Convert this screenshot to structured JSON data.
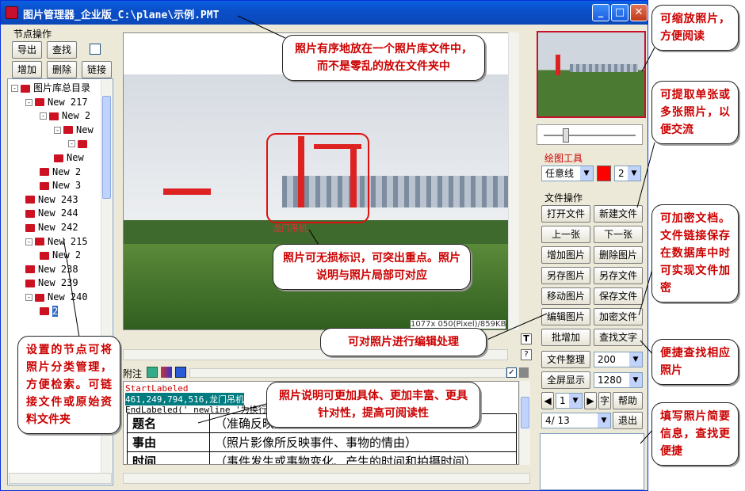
{
  "window": {
    "title": "图片管理器_企业版_C:\\plane\\示例.PMT",
    "buttons": {
      "minimize": "_",
      "maximize": "□",
      "close": "✕"
    }
  },
  "node_ops": {
    "label": "节点操作",
    "export": "导出",
    "find": "查找",
    "add": "增加",
    "delete": "删除",
    "link": "链接"
  },
  "tree": {
    "items": [
      {
        "label": "图片库总目录",
        "indent": 0,
        "expander": "-"
      },
      {
        "label": "New 217",
        "indent": 1,
        "expander": "-"
      },
      {
        "label": "New 2",
        "indent": 2,
        "expander": "-"
      },
      {
        "label": "New",
        "indent": 3,
        "expander": "-"
      },
      {
        "label": "",
        "indent": 4,
        "expander": "-"
      },
      {
        "label": "New",
        "indent": 3,
        "expander": ""
      },
      {
        "label": "New 2",
        "indent": 2,
        "expander": ""
      },
      {
        "label": "New 3",
        "indent": 2,
        "expander": ""
      },
      {
        "label": "New 243",
        "indent": 1,
        "expander": ""
      },
      {
        "label": "New 244",
        "indent": 1,
        "expander": ""
      },
      {
        "label": "New 242",
        "indent": 1,
        "expander": ""
      },
      {
        "label": "New 215",
        "indent": 1,
        "expander": "-"
      },
      {
        "label": "New 2",
        "indent": 2,
        "expander": ""
      },
      {
        "label": "New 238",
        "indent": 1,
        "expander": ""
      },
      {
        "label": "New 239",
        "indent": 1,
        "expander": ""
      },
      {
        "label": "New 240",
        "indent": 1,
        "expander": "-"
      },
      {
        "label": "2",
        "indent": 2,
        "expander": ""
      }
    ]
  },
  "image": {
    "label": "龙门吊机",
    "info": "1077x 050(Pixel)/859KB"
  },
  "notes": {
    "tab_label": "附注",
    "line1": "StartLabeled",
    "line2": "461,249,794,516,龙门吊机",
    "line3": "EndLabeled(' newline '为换行符",
    "rows": [
      {
        "key": "题名",
        "value": "（准确反映照片内容）"
      },
      {
        "key": "事由",
        "value": "（照片影像所反映事件、事物的情由）"
      },
      {
        "key": "时间",
        "value": "（事件发生或事物变化、产生的时间和拍摄时间）"
      }
    ]
  },
  "drawing_tools": {
    "label": "绘图工具",
    "line_type": "任意线",
    "line_width": "2",
    "color": "#ff0000"
  },
  "file_ops": {
    "label": "文件操作",
    "open_file": "打开文件",
    "new_file": "新建文件",
    "prev": "上一张",
    "next": "下一张",
    "add_image": "增加图片",
    "delete_image": "删除图片",
    "save_image_as": "另存图片",
    "save_file_as": "另存文件",
    "move_image": "移动图片",
    "save_file": "保存文件",
    "edit_image": "编辑图片",
    "encrypt_file": "加密文件",
    "batch_add": "批增加",
    "find_text": "查找文字",
    "organize": "文件整理",
    "organize_value": "200",
    "fullscreen": "全屏显示",
    "fullscreen_value": "1280",
    "page_value": "1",
    "font_button": "字",
    "help": "帮助",
    "pager": "4/ 13",
    "exit": "退出"
  },
  "callouts": {
    "library": "照片有序地放在一个照片库文件中，而不是零乱的放在文件夹中",
    "zoom": "可缩放照片，方便阅读",
    "extract": "可提取单张或多张照片，以便交流",
    "encrypt": "可加密文档。文件链接保存在数据库中时可实现文件加密",
    "mark": "照片可无损标识，可突出重点。照片说明与照片局部可对应",
    "edit": "可对照片进行编辑处理",
    "search": "便捷查找相应照片",
    "node": "设置的节点可将照片分类管理，方便检索。可链接文件或原始资料文件夹",
    "caption": "照片说明可更加具体、更加丰富、更具针对性，提高可阅读性",
    "info": "填写照片简要信息，查找更便捷"
  }
}
